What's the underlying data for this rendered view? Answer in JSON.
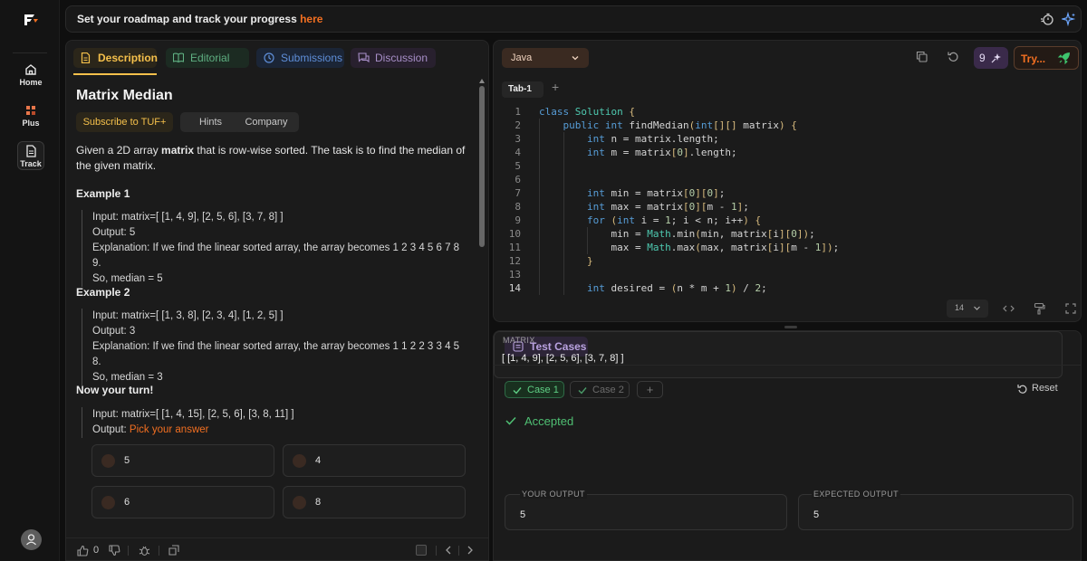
{
  "rail": {
    "items": [
      {
        "label": "Home"
      },
      {
        "label": "Plus"
      },
      {
        "label": "Track"
      }
    ]
  },
  "topbar": {
    "text": "Set your roadmap and track your progress ",
    "link": "here"
  },
  "desc_tabs": [
    "Description",
    "Editorial",
    "Submissions",
    "Discussion"
  ],
  "problem": {
    "title": "Matrix Median",
    "pills": [
      "Subscribe to TUF+",
      "Hints",
      "Company"
    ],
    "statement_pre": "Given a 2D array ",
    "statement_bold": "matrix",
    "statement_post": " that is row-wise sorted. The task is to find the median of the given matrix.",
    "examples": [
      {
        "title": "Example 1",
        "input": "Input: matrix=[ [1, 4, 9], [2, 5, 6], [3, 7, 8] ]",
        "output": "Output: 5",
        "explanation": "Explanation: If we find the linear sorted array, the array becomes 1 2 3 4 5 6 7 8 9.",
        "explanation2": "So, median = 5"
      },
      {
        "title": "Example 2",
        "input": "Input: matrix=[ [1, 3, 8], [2, 3, 4], [1, 2, 5] ]",
        "output": "Output: 3",
        "explanation": "Explanation: If we find the linear sorted array, the array becomes 1 1 2 2 3 3 4 5 8.",
        "explanation2": "So, median = 3"
      }
    ],
    "your_turn": {
      "title": "Now your turn!",
      "input": "Input: matrix=[ [1, 4, 15], [2, 5, 6], [3, 8, 11] ]",
      "output_label": "Output: ",
      "output_value": "Pick your answer"
    },
    "options": [
      "5",
      "4",
      "6",
      "8"
    ],
    "likes": "0"
  },
  "editor": {
    "language": "Java",
    "ai_count": "9",
    "try_label": "Try...",
    "tab": "Tab-1",
    "font_size": "14",
    "code_lines": [
      "class Solution {",
      "    public int findMedian(int[][] matrix) {",
      "        int n = matrix.length;",
      "        int m = matrix[0].length;",
      "",
      "",
      "        int min = matrix[0][0];",
      "        int max = matrix[0][m - 1];",
      "        for (int i = 1; i < n; i++) {",
      "            min = Math.min(min, matrix[i][0]);",
      "            max = Math.max(max, matrix[i][m - 1]);",
      "        }",
      "",
      "        int desired = (n * m + 1) / 2;"
    ]
  },
  "tests": {
    "tab": "Test Cases",
    "cases": [
      "Case 1",
      "Case 2"
    ],
    "reset": "Reset",
    "verdict": "Accepted",
    "matrix_label": "MATRIX",
    "matrix_value": "[ [1, 4, 9], [2, 5, 6], [3, 7, 8] ]",
    "your_output_label": "YOUR OUTPUT",
    "your_output": "5",
    "expected_label": "EXPECTED OUTPUT",
    "expected": "5"
  },
  "colors": {
    "accent": "#f26f21",
    "description_tab": "#f5c04b",
    "accepted": "#4fbf73"
  }
}
